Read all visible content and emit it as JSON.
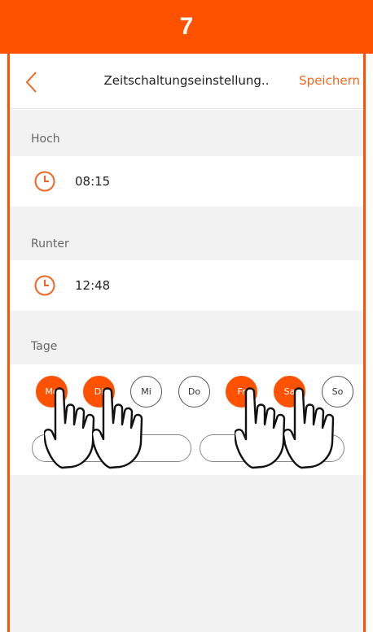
{
  "banner": {
    "step": "7"
  },
  "header": {
    "title": "Zeitschaltungseinstellung..",
    "save_label": "Speichern"
  },
  "sections": {
    "up": {
      "label": "Hoch",
      "time": "08:15"
    },
    "down": {
      "label": "Runter",
      "time": "12:48"
    },
    "days": {
      "label": "Tage"
    }
  },
  "days": [
    {
      "label": "Mo",
      "selected": true
    },
    {
      "label": "Di",
      "selected": true
    },
    {
      "label": "Mi",
      "selected": false
    },
    {
      "label": "Do",
      "selected": false
    },
    {
      "label": "Fr",
      "selected": true
    },
    {
      "label": "Sa",
      "selected": true
    },
    {
      "label": "So",
      "selected": false
    }
  ],
  "presets": {
    "left_label": "...gl..",
    "right_label": "L.."
  },
  "colors": {
    "accent": "#ff5200",
    "save_text": "#f26522",
    "background_gray": "#f2f2f2"
  },
  "icons": {
    "back": "chevron-left-icon",
    "clock": "clock-icon",
    "hand": "pointing-hand-icon"
  }
}
